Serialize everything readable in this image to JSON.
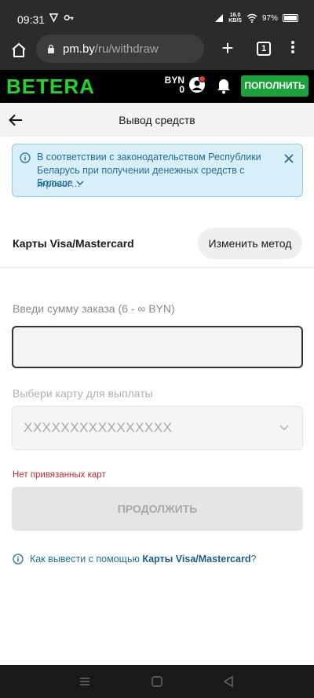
{
  "status": {
    "time": "09:31",
    "speed_top": "16.0",
    "speed_bottom": "KB/S",
    "battery": "97%"
  },
  "browser": {
    "host": "pm.by",
    "path": "/ru/withdraw",
    "tab_count": "1"
  },
  "site": {
    "logo": "BETERA",
    "currency": "BYN",
    "balance": "0",
    "topup_label": "ПОПОЛНИТЬ",
    "brand_color": "#1ed72d"
  },
  "page": {
    "title": "Вывод средств"
  },
  "notice": {
    "text": "В соответствии с законодательством Республики Беларусь при получении денежных средств с игровог…",
    "more_label": "Больше"
  },
  "method": {
    "name": "Карты Visa/Mastercard",
    "change_label": "Изменить метод"
  },
  "form": {
    "amount_label": "Введи сумму заказа (6 - ∞ BYN)",
    "amount_value": "",
    "card_label": "Выбери карту для выплаты",
    "card_value": "XXXXXXXXXXXXXXXX",
    "error": "Нет привязанных карт",
    "continue_label": "ПРОДОЛЖИТЬ"
  },
  "help": {
    "prefix": "Как вывести с помощью",
    "method": "Карты Visa/Mastercard",
    "suffix": "?"
  }
}
